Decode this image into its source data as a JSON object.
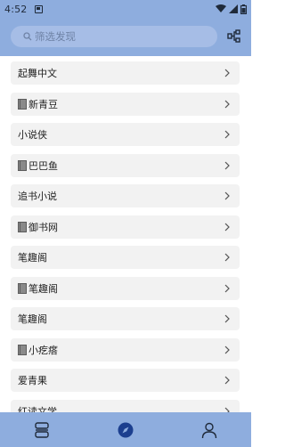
{
  "status_bar": {
    "time": "4:52"
  },
  "search": {
    "placeholder": "筛选发现"
  },
  "sources": [
    {
      "label": "起舞中文",
      "has_book_icon": false
    },
    {
      "label": "新青豆",
      "has_book_icon": true
    },
    {
      "label": "小说侠",
      "has_book_icon": false
    },
    {
      "label": "巴巴鱼",
      "has_book_icon": true
    },
    {
      "label": "追书小说",
      "has_book_icon": false
    },
    {
      "label": "御书网",
      "has_book_icon": true
    },
    {
      "label": "笔趣阁",
      "has_book_icon": false
    },
    {
      "label": "笔趣阁",
      "has_book_icon": true
    },
    {
      "label": "笔趣阁",
      "has_book_icon": false
    },
    {
      "label": "小疙瘩",
      "has_book_icon": true
    },
    {
      "label": "爱青果",
      "has_book_icon": false
    },
    {
      "label": "红读文学",
      "has_book_icon": false
    }
  ],
  "bottom_nav": [
    {
      "name": "bookshelf-icon",
      "active": false
    },
    {
      "name": "compass-icon",
      "active": true
    },
    {
      "name": "person-icon",
      "active": false
    }
  ],
  "colors": {
    "header_bg": "#8eadde",
    "search_bg": "#a6bde6",
    "item_bg": "#f2f2f2",
    "active_tab": "#1c3f8f"
  }
}
